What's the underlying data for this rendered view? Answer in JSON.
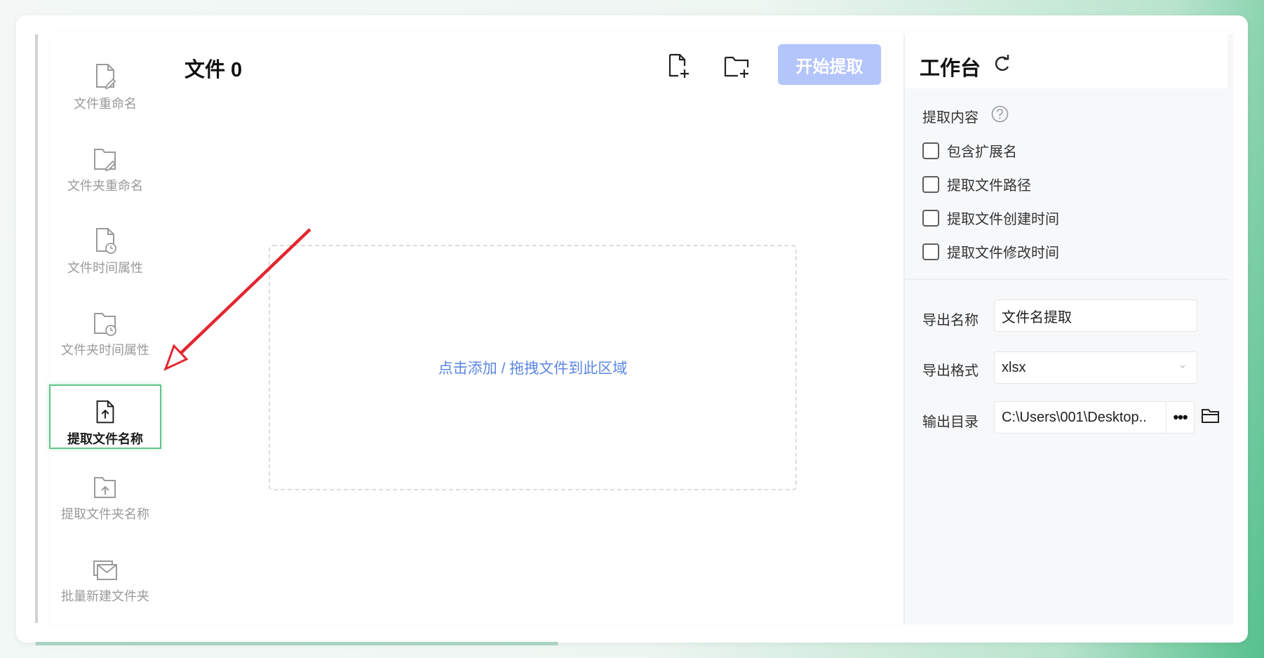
{
  "sidebar": {
    "items": [
      {
        "label": "文件重命名",
        "icon": "file-edit-icon"
      },
      {
        "label": "文件夹重命名",
        "icon": "folder-edit-icon"
      },
      {
        "label": "文件时间属性",
        "icon": "file-clock-icon"
      },
      {
        "label": "文件夹时间属性",
        "icon": "folder-clock-icon"
      },
      {
        "label": "提取文件名称",
        "icon": "file-upload-icon",
        "active": true
      },
      {
        "label": "提取文件夹名称",
        "icon": "folder-upload-icon"
      },
      {
        "label": "批量新建文件夹",
        "icon": "folders-batch-icon"
      }
    ]
  },
  "header": {
    "title": "文件 0",
    "add_file_icon": "add-file-icon",
    "add_folder_icon": "add-folder-icon",
    "start_button": "开始提取"
  },
  "dropzone": {
    "text": "点击添加 / 拖拽文件到此区域"
  },
  "workbench": {
    "title": "工作台",
    "refresh_icon": "refresh-icon",
    "extract_content_label": "提取内容",
    "help_icon": "help-icon",
    "options": [
      {
        "label": "包含扩展名",
        "checked": false
      },
      {
        "label": "提取文件路径",
        "checked": false
      },
      {
        "label": "提取文件创建时间",
        "checked": false
      },
      {
        "label": "提取文件修改时间",
        "checked": false
      }
    ],
    "export_name_label": "导出名称",
    "export_name_value": "文件名提取",
    "export_format_label": "导出格式",
    "export_format_value": "xlsx",
    "output_dir_label": "输出目录",
    "output_dir_value": "C:\\Users\\001\\Desktop..",
    "browse_button": "•••",
    "open_folder_icon": "open-folder-icon"
  },
  "colors": {
    "accent_blue": "#5b86e5",
    "button_disabled": "#b3c5fb",
    "active_border": "#62c587",
    "annotation_arrow": "#e3262f"
  }
}
